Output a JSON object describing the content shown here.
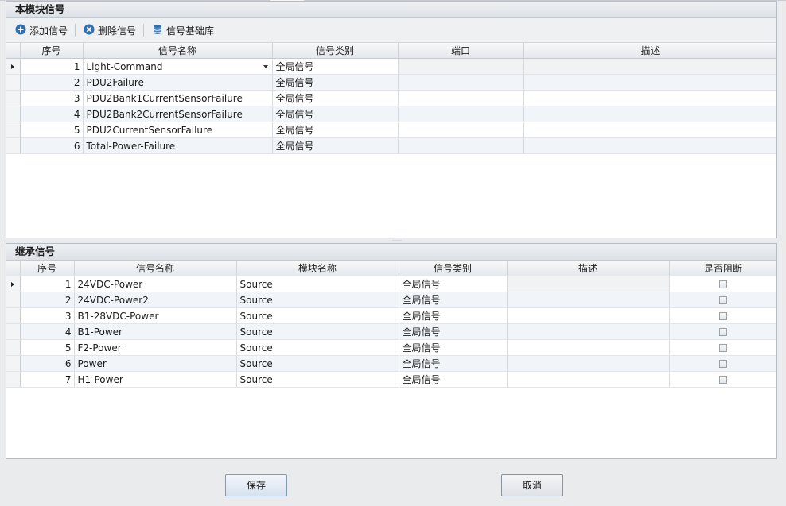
{
  "top_panel": {
    "title": "本模块信号",
    "toolbar": {
      "add_label": "添加信号",
      "delete_label": "删除信号",
      "library_label": "信号基础库"
    },
    "columns": [
      "序号",
      "信号名称",
      "信号类别",
      "端口",
      "描述"
    ],
    "rows": [
      {
        "index": "1",
        "name": "Light-Command",
        "category": "全局信号",
        "port": "",
        "desc": ""
      },
      {
        "index": "2",
        "name": "PDU2Failure",
        "category": "全局信号",
        "port": "",
        "desc": ""
      },
      {
        "index": "3",
        "name": "PDU2Bank1CurrentSensorFailure",
        "category": "全局信号",
        "port": "",
        "desc": ""
      },
      {
        "index": "4",
        "name": "PDU2Bank2CurrentSensorFailure",
        "category": "全局信号",
        "port": "",
        "desc": ""
      },
      {
        "index": "5",
        "name": "PDU2CurrentSensorFailure",
        "category": "全局信号",
        "port": "",
        "desc": ""
      },
      {
        "index": "6",
        "name": "Total-Power-Failure",
        "category": "全局信号",
        "port": "",
        "desc": ""
      }
    ]
  },
  "bottom_panel": {
    "title": "继承信号",
    "columns": [
      "序号",
      "信号名称",
      "模块名称",
      "信号类别",
      "描述",
      "是否阻断"
    ],
    "rows": [
      {
        "index": "1",
        "name": "24VDC-Power",
        "module": "Source",
        "category": "全局信号",
        "desc": "",
        "blocked": false
      },
      {
        "index": "2",
        "name": "24VDC-Power2",
        "module": "Source",
        "category": "全局信号",
        "desc": "",
        "blocked": false
      },
      {
        "index": "3",
        "name": "B1-28VDC-Power",
        "module": "Source",
        "category": "全局信号",
        "desc": "",
        "blocked": false
      },
      {
        "index": "4",
        "name": "B1-Power",
        "module": "Source",
        "category": "全局信号",
        "desc": "",
        "blocked": false
      },
      {
        "index": "5",
        "name": "F2-Power",
        "module": "Source",
        "category": "全局信号",
        "desc": "",
        "blocked": false
      },
      {
        "index": "6",
        "name": "Power",
        "module": "Source",
        "category": "全局信号",
        "desc": "",
        "blocked": false
      },
      {
        "index": "7",
        "name": "H1-Power",
        "module": "Source",
        "category": "全局信号",
        "desc": "",
        "blocked": false
      }
    ]
  },
  "buttons": {
    "save_label": "保存",
    "cancel_label": "取消"
  },
  "icons": {
    "add": "plus-circle-icon",
    "delete": "x-circle-icon",
    "library": "database-icon"
  },
  "colors": {
    "icon_blue": "#2f6fb3",
    "alt_row": "#f1f4f8"
  }
}
